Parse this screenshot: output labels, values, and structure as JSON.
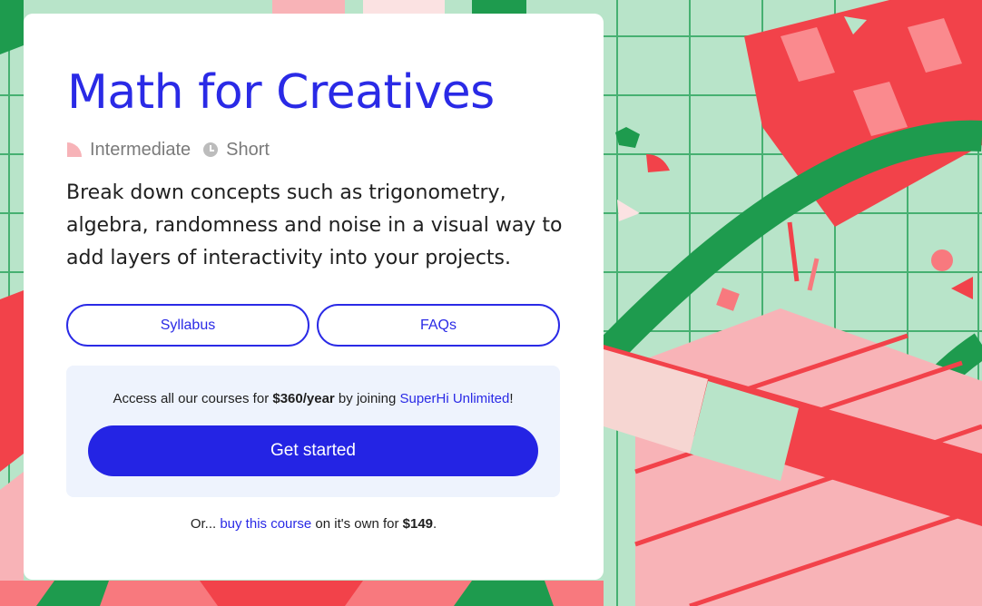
{
  "course": {
    "title": "Math for Creatives",
    "level": "Intermediate",
    "length": "Short",
    "description": "Break down concepts such as trigonometry, algebra, randomness and noise in a visual way to add layers of interactivity into your projects."
  },
  "buttons": {
    "syllabus": "Syllabus",
    "faqs": "FAQs",
    "get_started": "Get started"
  },
  "promo": {
    "prefix": "Access all our courses for ",
    "price": "$360/year",
    "middle": " by joining ",
    "link": "SuperHi Unlimited",
    "suffix": "!"
  },
  "footer": {
    "prefix": "Or... ",
    "link": "buy this course",
    "middle": " on it's own for ",
    "price": "$149",
    "suffix": "."
  },
  "colors": {
    "accent": "#2a2ae6",
    "primary_button": "#2424e4",
    "promo_bg": "#eef3fd",
    "illustration_green": "#1e9b4e",
    "illustration_red": "#f2424a",
    "illustration_pink": "#f8b3b7",
    "illustration_mint": "#b8e4c9"
  }
}
